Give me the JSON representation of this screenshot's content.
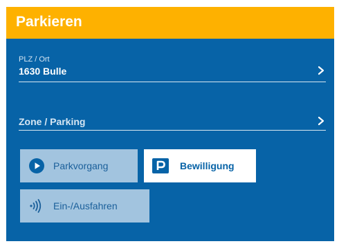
{
  "header": {
    "title": "Parkieren"
  },
  "location_field": {
    "caption": "PLZ / Ort",
    "value": "1630 Bulle",
    "icon": "chevron-right-icon"
  },
  "zone_field": {
    "placeholder": "Zone / Parking",
    "icon": "chevron-right-icon"
  },
  "actions": {
    "parkvorgang": {
      "label": "Parkvorgang",
      "icon": "play-circle-icon"
    },
    "bewilligung": {
      "label": "Bewilligung",
      "icon": "parking-sign-icon"
    },
    "einausfahren": {
      "label": "Ein-/Ausfahren",
      "icon": "contactless-icon"
    }
  },
  "colors": {
    "header": "#feb100",
    "panel": "#0763a7",
    "button_inactive": "#a2c4df",
    "button_active": "#ffffff"
  }
}
